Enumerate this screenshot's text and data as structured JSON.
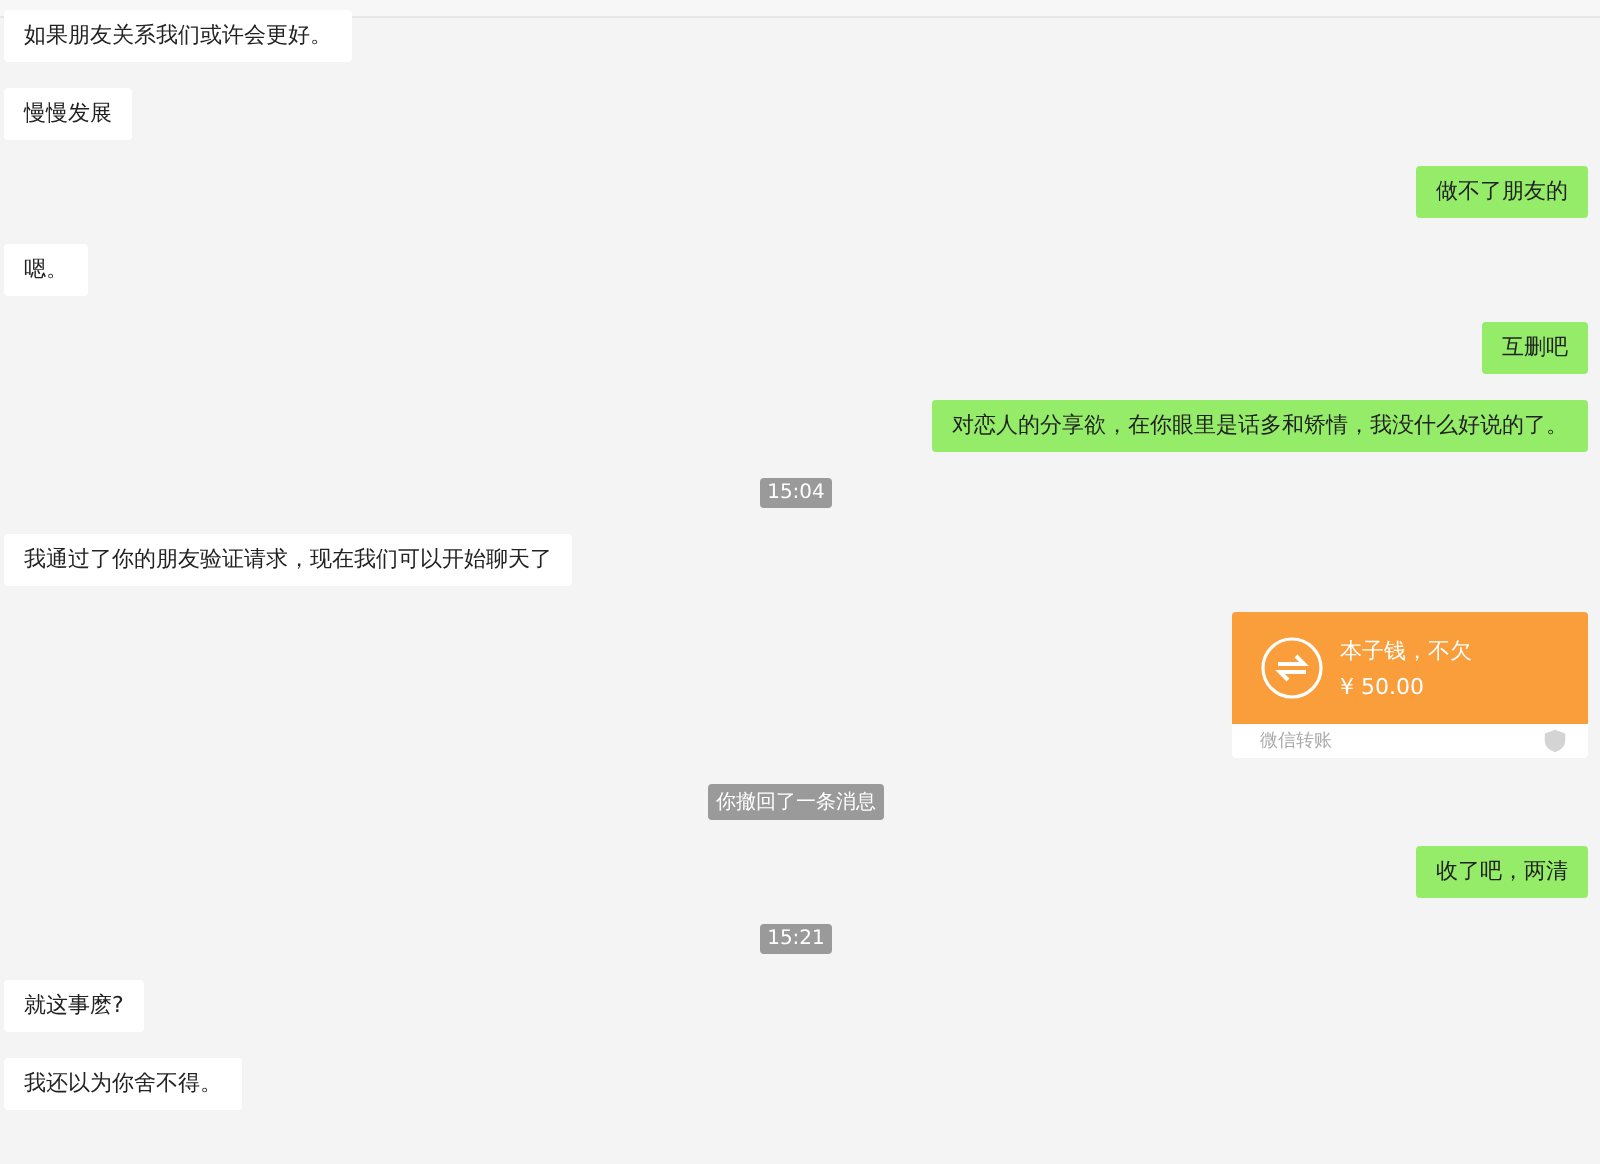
{
  "messages": [
    {
      "kind": "incoming",
      "text": "如果朋友关系我们或许会更好。"
    },
    {
      "kind": "incoming",
      "text": "慢慢发展"
    },
    {
      "kind": "outgoing",
      "text": "做不了朋友的"
    },
    {
      "kind": "incoming",
      "text": "嗯。"
    },
    {
      "kind": "outgoing",
      "text": "互删吧"
    },
    {
      "kind": "outgoing",
      "text": "对恋人的分享欲，在你眼里是话多和矫情，我没什么好说的了。"
    },
    {
      "kind": "time",
      "text": "15:04"
    },
    {
      "kind": "incoming",
      "text": "我通过了你的朋友验证请求，现在我们可以开始聊天了"
    },
    {
      "kind": "transfer",
      "text": "本子钱，不欠",
      "amount": "¥ 50.00",
      "footer": "微信转账"
    },
    {
      "kind": "system",
      "text": "你撤回了一条消息"
    },
    {
      "kind": "outgoing",
      "text": "收了吧，两清"
    },
    {
      "kind": "time",
      "text": "15:21"
    },
    {
      "kind": "incoming",
      "text": "就这事麽?"
    },
    {
      "kind": "incoming",
      "text": "我还以为你舍不得。"
    }
  ]
}
